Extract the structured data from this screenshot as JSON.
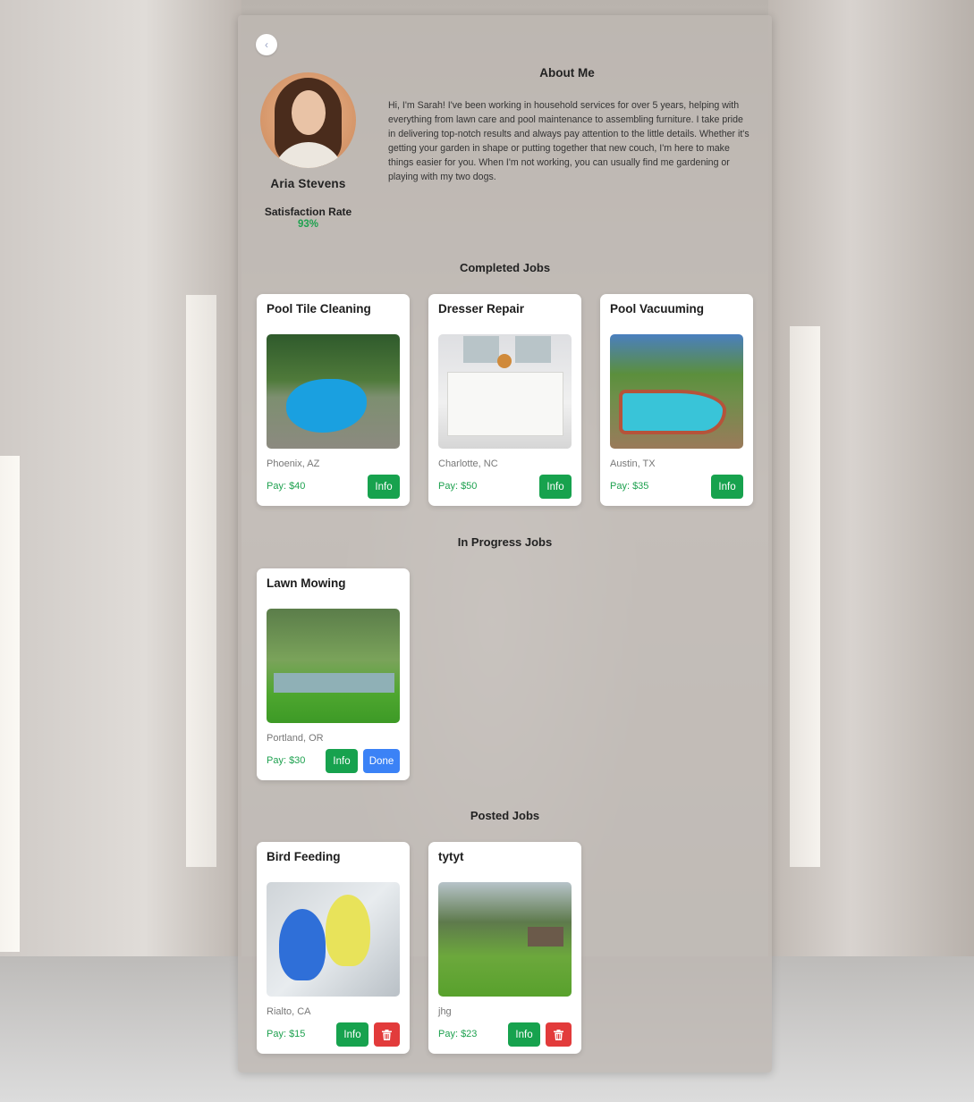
{
  "back_icon": "chevron-left-icon",
  "profile": {
    "name": "Aria Stevens",
    "satisfaction_label": "Satisfaction Rate",
    "satisfaction_value": "93%"
  },
  "about": {
    "title": "About Me",
    "text": "Hi, I'm Sarah! I've been working in household services for over 5 years, helping with everything from lawn care and pool maintenance to assembling furniture. I take pride in delivering top-notch results and always pay attention to the little details. Whether it's getting your garden in shape or putting together that new couch, I'm here to make things easier for you. When I'm not working, you can usually find me gardening or playing with my two dogs."
  },
  "sections": {
    "completed": "Completed Jobs",
    "in_progress": "In Progress Jobs",
    "posted": "Posted Jobs"
  },
  "completed_jobs": [
    {
      "title": "Pool Tile Cleaning",
      "location": "Phoenix, AZ",
      "pay": "Pay: $40",
      "info_label": "Info"
    },
    {
      "title": "Dresser Repair",
      "location": "Charlotte, NC",
      "pay": "Pay: $50",
      "info_label": "Info"
    },
    {
      "title": "Pool Vacuuming",
      "location": "Austin, TX",
      "pay": "Pay: $35",
      "info_label": "Info"
    }
  ],
  "in_progress_jobs": [
    {
      "title": "Lawn Mowing",
      "location": "Portland, OR",
      "pay": "Pay: $30",
      "info_label": "Info",
      "done_label": "Done"
    }
  ],
  "posted_jobs": [
    {
      "title": "Bird Feeding",
      "location": "Rialto, CA",
      "pay": "Pay: $15",
      "info_label": "Info",
      "delete_icon": "trash-icon"
    },
    {
      "title": "tytyt",
      "location": "jhg",
      "pay": "Pay: $23",
      "info_label": "Info",
      "delete_icon": "trash-icon"
    }
  ],
  "colors": {
    "accent_green": "#17a24e",
    "done_blue": "#3b82f6",
    "delete_red": "#e23b3b"
  }
}
